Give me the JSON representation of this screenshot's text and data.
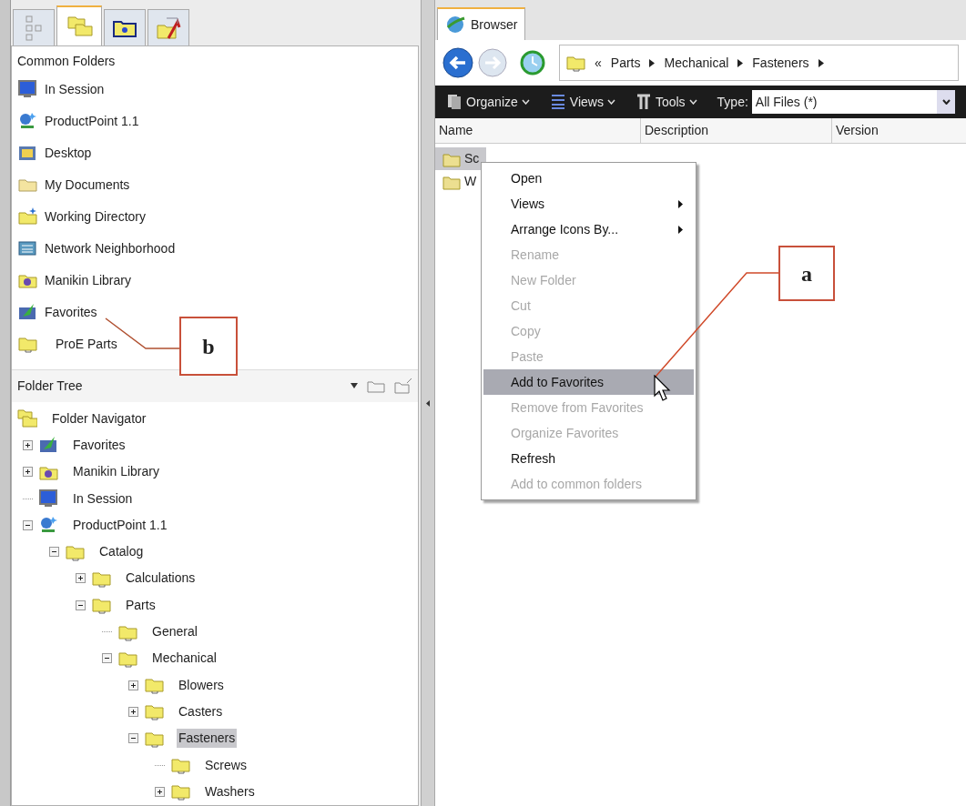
{
  "left_tabs": [
    {
      "kind": "tree",
      "selected": false
    },
    {
      "kind": "folders",
      "selected": true
    },
    {
      "kind": "favorites",
      "selected": false
    },
    {
      "kind": "shortcut",
      "selected": false
    }
  ],
  "common_folders": {
    "title": "Common Folders",
    "items": [
      {
        "label": "In Session",
        "kind": "session"
      },
      {
        "label": "ProductPoint 1.1",
        "kind": "server"
      },
      {
        "label": "Desktop",
        "kind": "desktop"
      },
      {
        "label": "My Documents",
        "kind": "documents"
      },
      {
        "label": "Working Directory",
        "kind": "workdir"
      },
      {
        "label": "Network Neighborhood",
        "kind": "network"
      },
      {
        "label": "Manikin Library",
        "kind": "library"
      },
      {
        "label": "Favorites",
        "kind": "favorites"
      },
      {
        "label": "ProE Parts",
        "kind": "folder"
      }
    ]
  },
  "folder_tree": {
    "title": "Folder Tree",
    "root": {
      "label": "Folder Navigator",
      "kind": "navigator",
      "selected": false,
      "children": [
        {
          "label": "Favorites",
          "kind": "favorites",
          "expanded": false,
          "selected": false
        },
        {
          "label": "Manikin Library",
          "kind": "library",
          "expanded": false,
          "selected": false
        },
        {
          "label": "In Session",
          "kind": "session",
          "selected": false
        },
        {
          "label": "ProductPoint 1.1",
          "kind": "server",
          "expanded": true,
          "selected": false,
          "children": [
            {
              "label": "Catalog",
              "kind": "folder",
              "expanded": true,
              "selected": false,
              "children": [
                {
                  "label": "Calculations",
                  "kind": "folder",
                  "expanded": false,
                  "selected": false
                },
                {
                  "label": "Parts",
                  "kind": "folder",
                  "expanded": true,
                  "selected": false,
                  "children": [
                    {
                      "label": "General",
                      "kind": "folder",
                      "selected": false
                    },
                    {
                      "label": "Mechanical",
                      "kind": "folder",
                      "expanded": true,
                      "selected": false,
                      "children": [
                        {
                          "label": "Blowers",
                          "kind": "folder",
                          "expanded": false,
                          "selected": false
                        },
                        {
                          "label": "Casters",
                          "kind": "folder",
                          "expanded": false,
                          "selected": false
                        },
                        {
                          "label": "Fasteners",
                          "kind": "folder",
                          "expanded": true,
                          "selected": true,
                          "children": [
                            {
                              "label": "Screws",
                              "kind": "folder",
                              "selected": false
                            },
                            {
                              "label": "Washers",
                              "kind": "folder",
                              "expanded": false,
                              "selected": false
                            }
                          ]
                        }
                      ]
                    }
                  ]
                }
              ]
            }
          ]
        }
      ]
    }
  },
  "browser": {
    "tab": "Browser",
    "address": {
      "prefix": "«",
      "segments": [
        "Parts",
        "Mechanical",
        "Fasteners"
      ]
    },
    "toolbar": {
      "buttons": [
        "Organize",
        "Views",
        "Tools"
      ],
      "type_label": "Type:",
      "type_value": "All Files (*)"
    },
    "columns": [
      "Name",
      "Description",
      "Version"
    ],
    "rows": [
      {
        "name": "Sc",
        "selected": true
      },
      {
        "name": "W",
        "selected": false
      }
    ]
  },
  "context_menu": [
    {
      "label": "Open",
      "disabled": false,
      "selected": false,
      "submenu": false
    },
    {
      "label": "Views",
      "disabled": false,
      "selected": false,
      "submenu": true
    },
    {
      "label": "Arrange Icons By...",
      "disabled": false,
      "selected": false,
      "submenu": true
    },
    {
      "label": "Rename",
      "disabled": true,
      "selected": false,
      "submenu": false
    },
    {
      "label": "New Folder",
      "disabled": true,
      "selected": false,
      "submenu": false
    },
    {
      "label": "Cut",
      "disabled": true,
      "selected": false,
      "submenu": false
    },
    {
      "label": "Copy",
      "disabled": true,
      "selected": false,
      "submenu": false
    },
    {
      "label": "Paste",
      "disabled": true,
      "selected": false,
      "submenu": false
    },
    {
      "label": "Add to Favorites",
      "disabled": false,
      "selected": true,
      "submenu": false
    },
    {
      "label": "Remove from Favorites",
      "disabled": true,
      "selected": false,
      "submenu": false
    },
    {
      "label": "Organize Favorites",
      "disabled": true,
      "selected": false,
      "submenu": false
    },
    {
      "label": "Refresh",
      "disabled": false,
      "selected": false,
      "submenu": false
    },
    {
      "label": "Add to common folders",
      "disabled": true,
      "selected": false,
      "submenu": false
    }
  ],
  "callouts": [
    {
      "label": "a"
    },
    {
      "label": "b"
    }
  ]
}
